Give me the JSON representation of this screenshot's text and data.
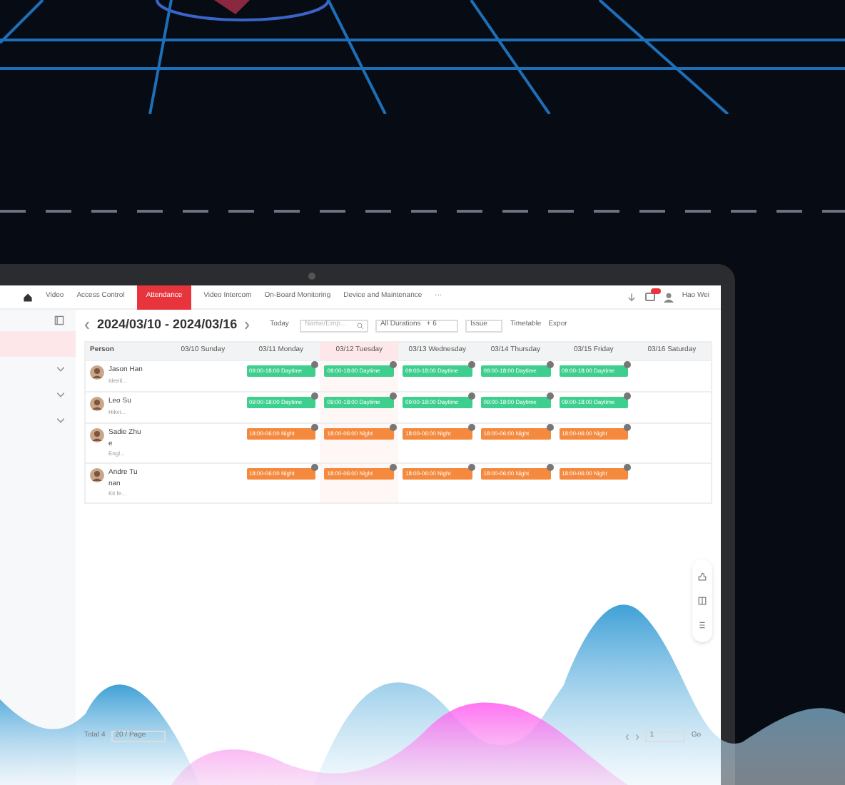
{
  "nav": {
    "items": [
      {
        "label": "Video",
        "selected": false
      },
      {
        "label": "Access Control",
        "selected": false
      },
      {
        "label": "Attendance",
        "selected": true
      },
      {
        "label": "Video Intercom",
        "selected": false
      },
      {
        "label": "On-Board Monitoring",
        "selected": false
      },
      {
        "label": "Device and Maintenance",
        "selected": false
      },
      {
        "label": "···",
        "selected": false
      }
    ],
    "user": "Hao Wei"
  },
  "sidebar": {
    "items": [
      {
        "selected": true,
        "expandable": false
      },
      {
        "selected": false,
        "expandable": true
      },
      {
        "selected": false,
        "expandable": true
      },
      {
        "selected": false,
        "expandable": true
      }
    ]
  },
  "toolbar": {
    "date_range": "2024/03/10 - 2024/03/16",
    "today": "Today",
    "search_placeholder": "Name/Emp...",
    "duration": "All Durations",
    "extra": "+ 6",
    "status": "Issue",
    "timetable": "Timetable",
    "export": "Expor"
  },
  "table": {
    "columns": [
      {
        "label": "Person",
        "highlighted": false
      },
      {
        "label": "03/10 Sunday",
        "highlighted": false
      },
      {
        "label": "03/11 Monday",
        "highlighted": false
      },
      {
        "label": "03/12 Tuesday",
        "highlighted": true
      },
      {
        "label": "03/13 Wednesday",
        "highlighted": false
      },
      {
        "label": "03/14 Thursday",
        "highlighted": false
      },
      {
        "label": "03/15 Friday",
        "highlighted": false
      },
      {
        "label": "03/16 Saturday",
        "highlighted": false
      }
    ],
    "rows": [
      {
        "name": "Jason Han",
        "dept": "Identi...",
        "shifts": [
          {
            "kind": "none"
          },
          {
            "kind": "day",
            "text": "09:00-18:00 Daytime"
          },
          {
            "kind": "day",
            "text": "09:00-18:00 Daytime"
          },
          {
            "kind": "day",
            "text": "09:00-18:00 Daytime"
          },
          {
            "kind": "day",
            "text": "09:00-18:00 Daytime"
          },
          {
            "kind": "day",
            "text": "09:00-18:00 Daytime"
          },
          {
            "kind": "none"
          }
        ]
      },
      {
        "name": "Leo Su",
        "dept": "Hikvi...",
        "shifts": [
          {
            "kind": "none"
          },
          {
            "kind": "day",
            "text": "09:00-18:00 Daytime"
          },
          {
            "kind": "day",
            "text": "09:00-18:00 Daytime"
          },
          {
            "kind": "day",
            "text": "09:00-18:00 Daytime"
          },
          {
            "kind": "day",
            "text": "09:00-18:00 Daytime"
          },
          {
            "kind": "day",
            "text": "09:00-18:00 Daytime"
          },
          {
            "kind": "none"
          }
        ]
      },
      {
        "name": "Sadie Zhu e",
        "dept": "Engl...",
        "shifts": [
          {
            "kind": "none"
          },
          {
            "kind": "night",
            "text": "18:00-06:00 Night"
          },
          {
            "kind": "night",
            "text": "18:00-06:00 Night"
          },
          {
            "kind": "night",
            "text": "18:00-06:00 Night"
          },
          {
            "kind": "night",
            "text": "18:00-06:00 Night"
          },
          {
            "kind": "night",
            "text": "18:00-06:00 Night"
          },
          {
            "kind": "none"
          }
        ]
      },
      {
        "name": "Andre Tu nan",
        "dept": "Kit fe...",
        "shifts": [
          {
            "kind": "none"
          },
          {
            "kind": "night",
            "text": "18:00-06:00 Night"
          },
          {
            "kind": "night",
            "text": "18:00-06:00 Night"
          },
          {
            "kind": "night",
            "text": "18:00-06:00 Night"
          },
          {
            "kind": "night",
            "text": "18:00-06:00 Night"
          },
          {
            "kind": "night",
            "text": "18:00-06:00 Night"
          },
          {
            "kind": "none"
          }
        ]
      }
    ]
  },
  "footer": {
    "total": "Total 4",
    "page_size": "20 / Page",
    "page": "1",
    "go": "Go"
  }
}
